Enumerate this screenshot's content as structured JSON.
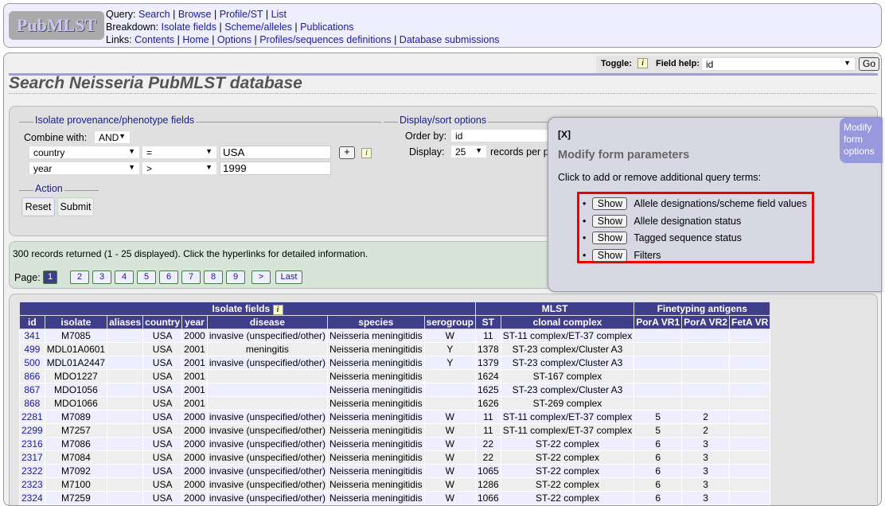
{
  "nav": {
    "logo": "PubMLST",
    "query_label": "Query:",
    "query": [
      "Search",
      "Browse",
      "Profile/ST",
      "List"
    ],
    "breakdown_label": "Breakdown:",
    "breakdown": [
      "Isolate fields",
      "Scheme/alleles",
      "Publications"
    ],
    "links_label": "Links:",
    "links": [
      "Contents",
      "Home",
      "Options",
      "Profiles/sequences definitions",
      "Database submissions"
    ]
  },
  "helpbar": {
    "toggle_label": "Toggle:",
    "field_help_label": "Field help:",
    "field_help_value": "id",
    "go": "Go"
  },
  "title": "Search Neisseria PubMLST database",
  "form": {
    "provenance_legend": "Isolate provenance/phenotype fields",
    "combine_label": "Combine with:",
    "combine_value": "AND",
    "terms": [
      {
        "field": "country",
        "op": "=",
        "value": "USA"
      },
      {
        "field": "year",
        "op": ">",
        "value": "1999"
      }
    ],
    "add": "+",
    "action_legend": "Action",
    "reset": "Reset",
    "submit": "Submit",
    "display_legend": "Display/sort options",
    "order_label": "Order by:",
    "order_value": "id",
    "display_label": "Display:",
    "display_value": "25",
    "records_per_page": "records per p"
  },
  "results": {
    "summary": "300 records returned (1 - 25 displayed). Click the hyperlinks for detailed information.",
    "page_label": "Page:",
    "pages": [
      "1",
      "2",
      "3",
      "4",
      "5",
      "6",
      "7",
      "8",
      "9",
      ">",
      "Last"
    ],
    "current_page": "1"
  },
  "popup": {
    "close": "[X]",
    "title": "Modify form parameters",
    "intro": "Click to add or remove additional query terms:",
    "show": "Show",
    "options": [
      "Allele designations/scheme field values",
      "Allele designation status",
      "Tagged sequence status",
      "Filters"
    ],
    "tab": "Modify form options"
  },
  "table": {
    "groups": [
      "Isolate fields",
      "MLST",
      "Finetyping antigens"
    ],
    "columns": [
      "id",
      "isolate",
      "aliases",
      "country",
      "year",
      "disease",
      "species",
      "serogroup",
      "ST",
      "clonal complex",
      "PorA VR1",
      "PorA VR2",
      "FetA VR"
    ],
    "rows": [
      [
        "341",
        "M7085",
        "",
        "USA",
        "2000",
        "invasive (unspecified/other)",
        "Neisseria meningitidis",
        "W",
        "11",
        "ST-11 complex/ET-37 complex",
        "",
        "",
        ""
      ],
      [
        "499",
        "MDL01A0601",
        "",
        "USA",
        "2001",
        "meningitis",
        "Neisseria meningitidis",
        "Y",
        "1378",
        "ST-23 complex/Cluster A3",
        "",
        "",
        ""
      ],
      [
        "500",
        "MDL01A2447",
        "",
        "USA",
        "2001",
        "invasive (unspecified/other)",
        "Neisseria meningitidis",
        "Y",
        "1379",
        "ST-23 complex/Cluster A3",
        "",
        "",
        ""
      ],
      [
        "866",
        "MDO1227",
        "",
        "USA",
        "2001",
        "",
        "Neisseria meningitidis",
        "",
        "1624",
        "ST-167 complex",
        "",
        "",
        ""
      ],
      [
        "867",
        "MDO1056",
        "",
        "USA",
        "2001",
        "",
        "Neisseria meningitidis",
        "",
        "1625",
        "ST-23 complex/Cluster A3",
        "",
        "",
        ""
      ],
      [
        "868",
        "MDO1066",
        "",
        "USA",
        "2001",
        "",
        "Neisseria meningitidis",
        "",
        "1626",
        "ST-269 complex",
        "",
        "",
        ""
      ],
      [
        "2281",
        "M7089",
        "",
        "USA",
        "2000",
        "invasive (unspecified/other)",
        "Neisseria meningitidis",
        "W",
        "11",
        "ST-11 complex/ET-37 complex",
        "5",
        "2",
        ""
      ],
      [
        "2299",
        "M7257",
        "",
        "USA",
        "2000",
        "invasive (unspecified/other)",
        "Neisseria meningitidis",
        "W",
        "11",
        "ST-11 complex/ET-37 complex",
        "5",
        "2",
        ""
      ],
      [
        "2316",
        "M7086",
        "",
        "USA",
        "2000",
        "invasive (unspecified/other)",
        "Neisseria meningitidis",
        "W",
        "22",
        "ST-22 complex",
        "6",
        "3",
        ""
      ],
      [
        "2317",
        "M7084",
        "",
        "USA",
        "2000",
        "invasive (unspecified/other)",
        "Neisseria meningitidis",
        "W",
        "22",
        "ST-22 complex",
        "6",
        "3",
        ""
      ],
      [
        "2322",
        "M7092",
        "",
        "USA",
        "2000",
        "invasive (unspecified/other)",
        "Neisseria meningitidis",
        "W",
        "1065",
        "ST-22 complex",
        "6",
        "3",
        ""
      ],
      [
        "2323",
        "M7100",
        "",
        "USA",
        "2000",
        "invasive (unspecified/other)",
        "Neisseria meningitidis",
        "W",
        "1286",
        "ST-22 complex",
        "6",
        "3",
        ""
      ],
      [
        "2324",
        "M7259",
        "",
        "USA",
        "2000",
        "invasive (unspecified/other)",
        "Neisseria meningitidis",
        "W",
        "1066",
        "ST-22 complex",
        "6",
        "3",
        ""
      ]
    ]
  },
  "colors": {
    "header": "#3e3e8a",
    "highlight": "#ee0000",
    "tab": "#9898dd"
  }
}
